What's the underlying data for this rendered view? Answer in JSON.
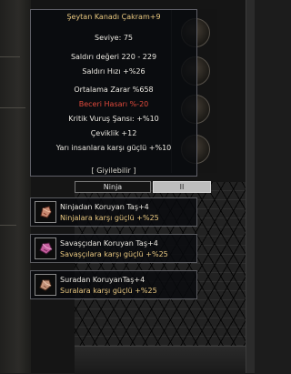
{
  "tooltip": {
    "title": "Şeytan Kanadı Çakram+9",
    "level": "Seviye: 75",
    "damage_value": "Saldırı değeri 220 - 229",
    "attack_speed": "Saldırı Hızı +%26",
    "avg_damage": "Ortalama Zarar %658",
    "skill_damage": "Beceri Hasarı %-20",
    "crit_chance": "Kritik Vuruş Şansı: +%10",
    "dexterity": "Çeviklik +12",
    "vs_half_human": "Yarı insanlara karşı güçlü +%10",
    "wearable": "[ Giyilebilir ]"
  },
  "tabs": {
    "ninja": "Ninja",
    "second": "II"
  },
  "stones": [
    {
      "name": "Ninjadan Koruyan Taş+4",
      "bonus": "Ninjalara karşı güçlü +%25",
      "icon": "stone-icon"
    },
    {
      "name": "Savaşçıdan Koruyan Taş+4",
      "bonus": "Savaşçılara karşı güçlü +%25",
      "icon": "stone-icon"
    },
    {
      "name": "Suradan KoruyanTaş+4",
      "bonus": "Suralara karşı güçlü +%25",
      "icon": "stone-icon"
    }
  ],
  "colors": {
    "gold": "#e9c880",
    "red": "#e04a3c",
    "white": "#ece9e2"
  }
}
